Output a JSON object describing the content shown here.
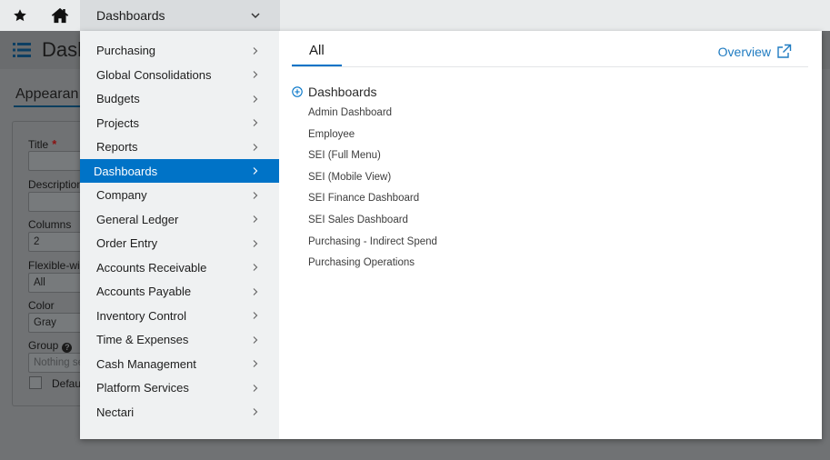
{
  "topbar": {
    "icons": {
      "favorites": "star-icon",
      "home": "home-icon"
    },
    "dropdown_label": "Dashboards"
  },
  "background_page": {
    "title": "Dash",
    "tab_label": "Appearan",
    "fields": [
      {
        "label": "Title",
        "required_mark": "*",
        "value": ""
      },
      {
        "label": "Description",
        "value": ""
      },
      {
        "label": "Columns",
        "value": "2"
      },
      {
        "label": "Flexible-wi",
        "value": "All"
      },
      {
        "label": "Color",
        "value": "Gray"
      },
      {
        "label": "Group",
        "value": "Nothing se"
      }
    ],
    "checkbox_label": "Defau"
  },
  "menu": {
    "categories": [
      {
        "label": "Purchasing"
      },
      {
        "label": "Global Consolidations"
      },
      {
        "label": "Budgets"
      },
      {
        "label": "Projects"
      },
      {
        "label": "Reports"
      },
      {
        "label": "Dashboards",
        "active": true
      },
      {
        "label": "Company"
      },
      {
        "label": "General Ledger"
      },
      {
        "label": "Order Entry"
      },
      {
        "label": "Accounts Receivable"
      },
      {
        "label": "Accounts Payable"
      },
      {
        "label": "Inventory Control"
      },
      {
        "label": "Time & Expenses"
      },
      {
        "label": "Cash Management"
      },
      {
        "label": "Platform Services"
      },
      {
        "label": "Nectari"
      }
    ],
    "tab_label": "All",
    "overview_label": "Overview",
    "section_title": "Dashboards",
    "links": [
      "Admin Dashboard",
      "Employee",
      "SEI (Full Menu)",
      "SEI (Mobile View)",
      "SEI Finance Dashboard",
      "SEI Sales Dashboard",
      "Purchasing - Indirect Spend",
      "Purchasing Operations"
    ]
  },
  "colors": {
    "accent": "#0073c7",
    "link": "#1f7bc1",
    "overlay": "#707274"
  }
}
